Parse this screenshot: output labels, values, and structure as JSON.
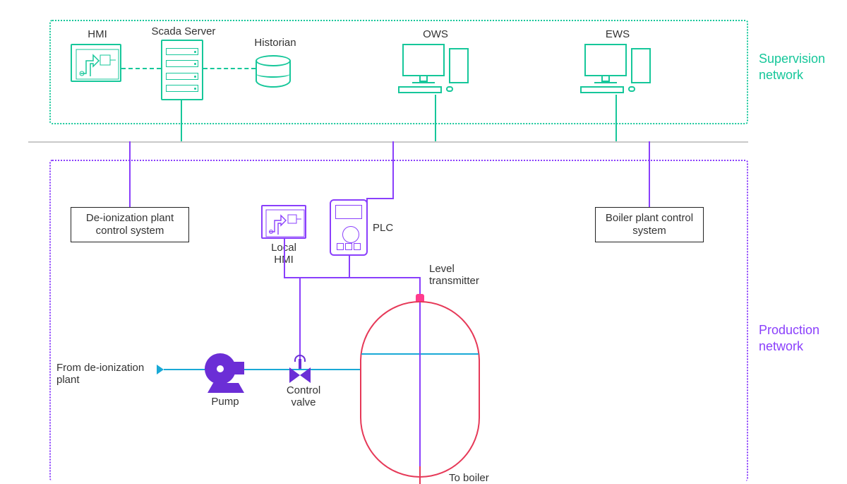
{
  "networks": {
    "supervision": "Supervision\nnetwork",
    "production": "Production\nnetwork"
  },
  "nodes": {
    "hmi": "HMI",
    "scada": "Scada Server",
    "historian": "Historian",
    "ows": "OWS",
    "ews": "EWS",
    "deion_cs": "De-ionization plant\ncontrol system",
    "local_hmi": "Local\nHMI",
    "plc": "PLC",
    "boiler_cs": "Boiler plant control\nsystem",
    "level_tx": "Level\ntransmitter",
    "from_deion": "From de-ionization\nplant",
    "control_valve": "Control\nvalve",
    "pump": "Pump",
    "to_boiler": "To boiler"
  }
}
